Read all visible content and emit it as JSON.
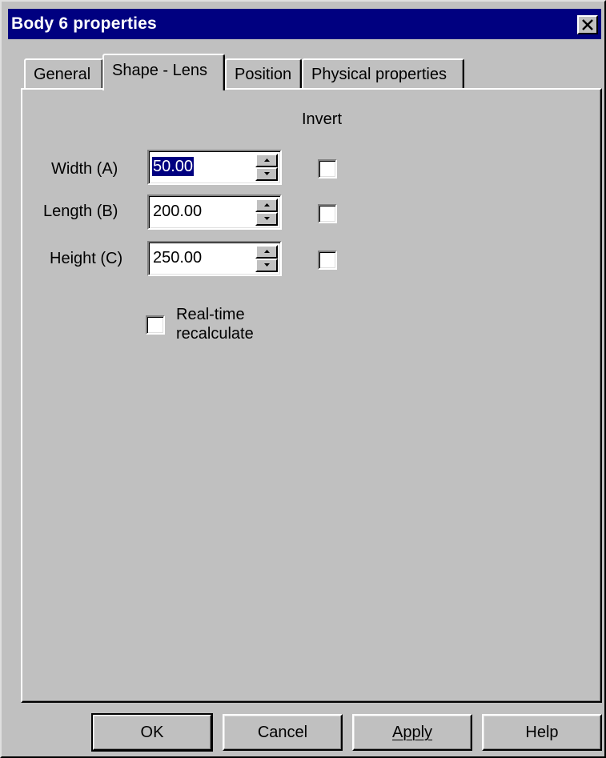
{
  "window": {
    "title": "Body 6 properties"
  },
  "tabs": [
    {
      "label": "General",
      "active": false
    },
    {
      "label": "Shape - Lens",
      "active": true
    },
    {
      "label": "Position",
      "active": false
    },
    {
      "label": "Physical properties",
      "active": false
    }
  ],
  "shape": {
    "invert_header": "Invert",
    "fields": [
      {
        "label": "Width (A)",
        "value": "50.00",
        "selected": true,
        "invert": false
      },
      {
        "label": "Length (B)",
        "value": "200.00",
        "selected": false,
        "invert": false
      },
      {
        "label": "Height (C)",
        "value": "250.00",
        "selected": false,
        "invert": false
      }
    ],
    "realtime": {
      "line1": "Real-time",
      "line2": "recalculate",
      "checked": false
    }
  },
  "buttons": {
    "ok": "OK",
    "cancel": "Cancel",
    "apply": "Apply",
    "help": "Help"
  },
  "colors": {
    "titlebar": "#000080",
    "face": "#c0c0c0",
    "selection": "#000080"
  }
}
